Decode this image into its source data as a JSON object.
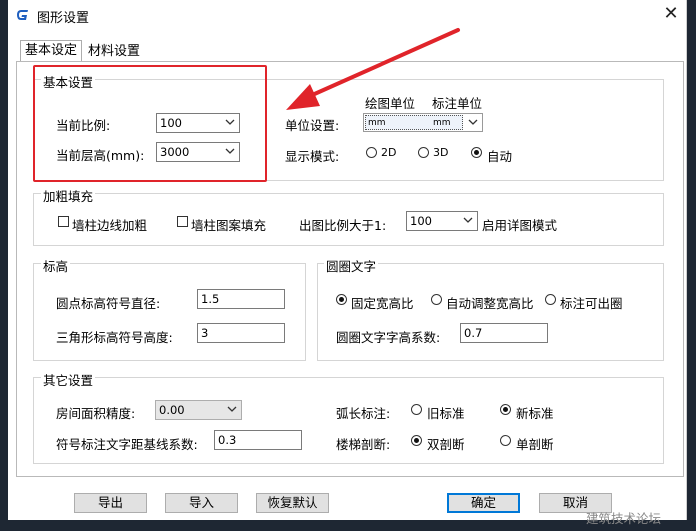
{
  "window": {
    "title": "图形设置",
    "close_glyph": "✕"
  },
  "tabs": [
    {
      "label": "基本设定",
      "active": true
    },
    {
      "label": "材料设置",
      "active": false
    }
  ],
  "basic": {
    "legend": "基本设置",
    "scale_label": "当前比例:",
    "scale_value": "100",
    "floor_height_label": "当前层高(mm):",
    "floor_height_value": "3000",
    "drawing_unit_header": "绘图单位",
    "annotation_unit_header": "标注单位",
    "unit_label": "单位设置:",
    "unit_value_1": "mm",
    "unit_value_2": "mm",
    "display_label": "显示模式:",
    "display_options": [
      "2D",
      "3D",
      "自动"
    ],
    "display_selected": 2
  },
  "thicken": {
    "legend": "加粗填充",
    "wall_edge_label": "墙柱边线加粗",
    "wall_pattern_label": "墙柱图案填充",
    "scale_gt_label": "出图比例大于1:",
    "scale_gt_value": "100",
    "detail_mode_label": "启用详图模式"
  },
  "elevation": {
    "legend": "标高",
    "dot_label": "圆点标高符号直径:",
    "dot_value": "1.5",
    "triangle_label": "三角形标高符号高度:",
    "triangle_value": "3"
  },
  "circle_text": {
    "legend": "圆圈文字",
    "options": [
      "固定宽高比",
      "自动调整宽高比",
      "标注可出圈"
    ],
    "selected": 0,
    "ratio_label": "圆圈文字字高系数:",
    "ratio_value": "0.7"
  },
  "other": {
    "legend": "其它设置",
    "area_label": "房间面积精度:",
    "area_value": "0.00",
    "symbol_label": "符号标注文字距基线系数:",
    "symbol_value": "0.3",
    "arc_label": "弧长标注:",
    "arc_options": [
      "旧标准",
      "新标准"
    ],
    "arc_selected": 1,
    "stair_label": "楼梯剖断:",
    "stair_options": [
      "双剖断",
      "单剖断"
    ],
    "stair_selected": 0
  },
  "buttons": {
    "export": "导出",
    "import": "导入",
    "reset": "恢复默认",
    "ok": "确定",
    "cancel": "取消"
  },
  "watermark": "建筑技术论坛",
  "colors": {
    "annotation": "#e0242a",
    "brand": "#1f5fbf",
    "default_button": "#0078d7"
  }
}
